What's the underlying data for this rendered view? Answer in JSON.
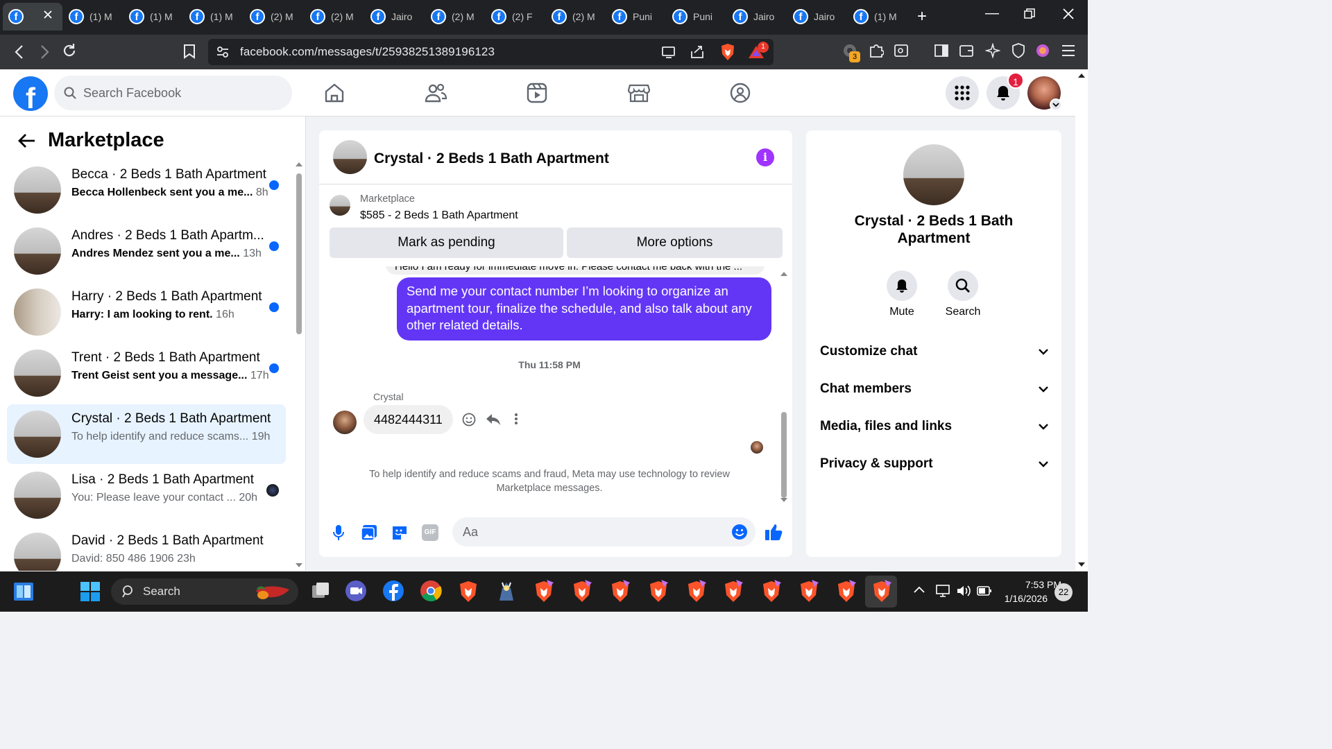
{
  "browser": {
    "tabs": [
      {
        "title": ""
      },
      {
        "title": "(1) M"
      },
      {
        "title": "(1) M"
      },
      {
        "title": "(1) M"
      },
      {
        "title": "(2) M"
      },
      {
        "title": "(2) M"
      },
      {
        "title": "Jairo"
      },
      {
        "title": "(2) M"
      },
      {
        "title": "(2) F"
      },
      {
        "title": "(2) M"
      },
      {
        "title": "Puni"
      },
      {
        "title": "Puni"
      },
      {
        "title": "Jairo"
      },
      {
        "title": "Jairo"
      },
      {
        "title": "(1) M"
      }
    ],
    "url": "facebook.com/messages/t/25938251389196123",
    "brave_badge": "1",
    "ext_badge": "3"
  },
  "fb": {
    "logo": "f",
    "search_placeholder": "Search Facebook",
    "notif_count": "1"
  },
  "sidebar": {
    "title": "Marketplace",
    "conversations": [
      {
        "title": "Becca · 2 Beds 1 Bath Apartment",
        "preview": "Becca Hollenbeck sent you a me...",
        "time": "8h",
        "unread": true
      },
      {
        "title": "Andres · 2 Beds 1 Bath Apartm...",
        "preview": "Andres Mendez sent you a me...",
        "time": "13h",
        "unread": true
      },
      {
        "title": "Harry · 2 Beds 1 Bath Apartment",
        "preview": "Harry: I am looking to rent.",
        "time": "16h",
        "unread": true
      },
      {
        "title": "Trent · 2 Beds 1 Bath Apartment",
        "preview": "Trent Geist sent you a message...",
        "time": "17h",
        "unread": true
      },
      {
        "title": "Crystal · 2 Beds 1 Bath Apartment",
        "preview": "To help identify and reduce scams...",
        "time": "19h",
        "unread": false,
        "selected": true
      },
      {
        "title": "Lisa · 2 Beds 1 Bath Apartment",
        "preview": "You: Please leave your contact ...",
        "time": "20h",
        "unread": false
      },
      {
        "title": "David · 2 Beds 1 Bath Apartment",
        "preview": "David: 850 486 1906",
        "time": "23h",
        "unread": false
      }
    ]
  },
  "chat": {
    "title": "Crystal · 2 Beds 1 Bath Apartment",
    "marketplace_label": "Marketplace",
    "listing": "$585 - 2 Beds 1 Bath Apartment",
    "mark_pending": "Mark as pending",
    "more_options": "More options",
    "partial_message": "Hello I am ready for immediate move in. Please contact me back with the ...",
    "outgoing_message": "Send me your contact number I’m looking to organize an apartment tour, finalize the schedule, and also talk about any other related details.",
    "timestamp": "Thu 11:58 PM",
    "sender": "Crystal",
    "incoming_message": "4482444311",
    "notice": "To help identify and reduce scams and fraud, Meta may use technology to review Marketplace messages.",
    "composer_placeholder": "Aa"
  },
  "details": {
    "title": "Crystal · 2 Beds 1 Bath Apartment",
    "mute": "Mute",
    "search": "Search",
    "sections": [
      "Customize chat",
      "Chat members",
      "Media, files and links",
      "Privacy & support"
    ]
  },
  "taskbar": {
    "search": "Search",
    "time": "7:53 PM",
    "date": "1/16/2026",
    "notif": "22"
  },
  "colors": {
    "fb_blue": "#1877f2",
    "messenger_purple": "#6336f5",
    "unread_dot": "#0866ff",
    "info_purple": "#a033ff"
  }
}
